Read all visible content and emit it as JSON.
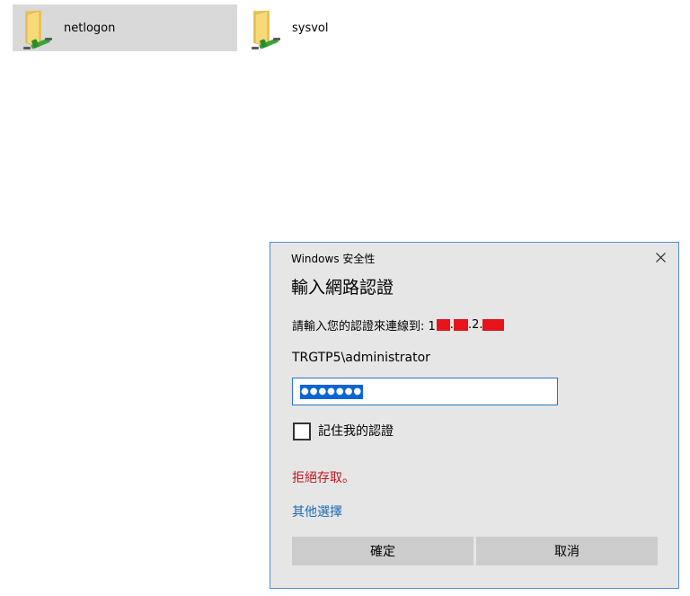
{
  "shares": [
    {
      "name": "netlogon",
      "icon": "network-folder-icon",
      "selected": true
    },
    {
      "name": "sysvol",
      "icon": "network-folder-icon",
      "selected": false
    }
  ],
  "dialog": {
    "caption": "Windows 安全性",
    "heading": "輸入網路認證",
    "connect_prefix": "請輸入您的認證來連線到: 1",
    "connect_sep1": ".",
    "connect_sep2": ".2.",
    "username": "TRGTP5\\administrator",
    "password_mask": "●●●●●●●",
    "remember_label": "記住我的認證",
    "remember_checked": false,
    "error_text": "拒絕存取。",
    "more_choices": "其他選擇",
    "ok_label": "確定",
    "cancel_label": "取消",
    "close_icon": "close-icon"
  },
  "colors": {
    "dialog_border": "#4f8bd6",
    "error": "#c0181e",
    "link": "#1e6ab8",
    "selection": "#0a64d6",
    "redaction": "#e8141b"
  }
}
